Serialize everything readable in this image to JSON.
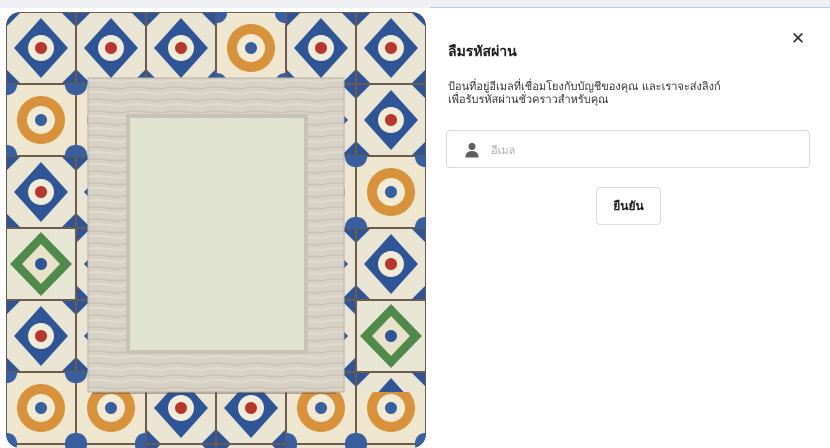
{
  "forgot_password": {
    "title": "ลืมรหัสผ่าน",
    "description_line1": "ป้อนที่อยู่อีเมลที่เชื่อมโยงกับบัญชีของคุณ และเราจะส่งลิงก์",
    "description_line2": "เพื่อรับรหัสผ่านชั่วคราวสำหรับคุณ",
    "email": {
      "placeholder": "อีเมล",
      "value": "",
      "icon": "user-icon"
    },
    "submit_label": "ยืนยัน",
    "close_label": "✕"
  },
  "image": {
    "subject": "decorative-tiles-with-empty-wooden-frame",
    "colors": {
      "grout": "#6e5a4c",
      "frame_wood": "#d8d2c6",
      "frame_inner": "#dfe3d0",
      "tile_blue": "#2f5597",
      "tile_orange": "#d8923b",
      "tile_green": "#4f8a4c"
    }
  }
}
